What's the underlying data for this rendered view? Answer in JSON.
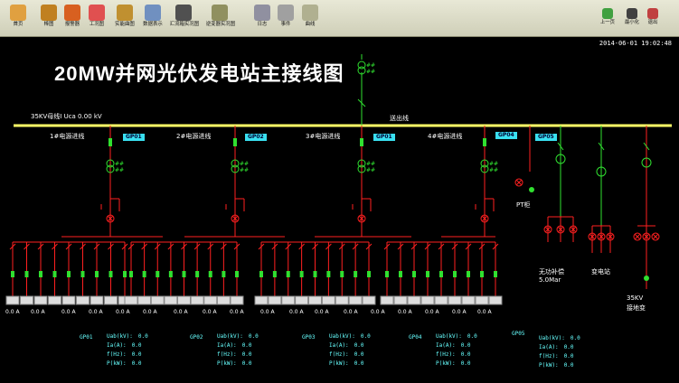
{
  "toolbar": {
    "items": [
      {
        "label": "首页",
        "color": "#e0a040"
      },
      {
        "label": "棒图",
        "color": "#c08020"
      },
      {
        "label": "报警器",
        "color": "#d86020"
      },
      {
        "label": "工况图",
        "color": "#e05050"
      },
      {
        "label": "实能曲图",
        "color": "#c09030"
      },
      {
        "label": "数据表示",
        "color": "#7090c0"
      },
      {
        "label": "汇流箱实况图",
        "color": "#505050"
      },
      {
        "label": "逆变器实况图",
        "color": "#909060"
      },
      {
        "label": "日志",
        "color": "#9090a0"
      },
      {
        "label": "事件",
        "color": "#a0a0a0"
      },
      {
        "label": "曲线",
        "color": "#b0b090"
      }
    ],
    "right_items": [
      {
        "label": "上一页",
        "color": "#40a040"
      },
      {
        "label": "最小化",
        "color": "#404040"
      },
      {
        "label": "退出",
        "color": "#c04040"
      }
    ]
  },
  "datetime": "2014-06-01 19:02:48",
  "title": "20MW并网光伏发电站主接线图",
  "bus_label": "35KV母线Ⅰ  Uca    0.00    kV",
  "outgoing_label": "送出线",
  "feeders": [
    {
      "label": "1#电源进线",
      "tag": "GP01"
    },
    {
      "label": "2#电源进线",
      "tag": "GP02"
    },
    {
      "label": "3#电源进线",
      "tag": "GP01"
    },
    {
      "label": "4#电源进线",
      "tag": "GP04"
    },
    {
      "tag": "GP05"
    }
  ],
  "right_labels": {
    "pt": "PT柜",
    "reactive": "无功补偿",
    "reactive_value": "5.0Mar",
    "substation": "变电站",
    "grounding_a": "35KV",
    "grounding_b": "接地变"
  },
  "transformer_mark": "##",
  "inverter_reading": "0.0  A",
  "panels": [
    {
      "tag": "GP01",
      "rows": [
        {
          "k": "Uab(kV):",
          "v": "0.0"
        },
        {
          "k": "Ia(A):",
          "v": "0.0"
        },
        {
          "k": "f(Hz):",
          "v": "0.0"
        },
        {
          "k": "P(kW):",
          "v": "0.0"
        }
      ]
    },
    {
      "tag": "GP02",
      "rows": [
        {
          "k": "Uab(kV):",
          "v": "0.0"
        },
        {
          "k": "Ia(A):",
          "v": "0.0"
        },
        {
          "k": "f(Hz):",
          "v": "0.0"
        },
        {
          "k": "P(kW):",
          "v": "0.0"
        }
      ]
    },
    {
      "tag": "GP03",
      "rows": [
        {
          "k": "Uab(kV):",
          "v": "0.0"
        },
        {
          "k": "Ia(A):",
          "v": "0.0"
        },
        {
          "k": "f(Hz):",
          "v": "0.0"
        },
        {
          "k": "P(kW):",
          "v": "0.0"
        }
      ]
    },
    {
      "tag": "GP04",
      "rows": [
        {
          "k": "Uab(kV):",
          "v": "0.0"
        },
        {
          "k": "Ia(A):",
          "v": "0.0"
        },
        {
          "k": "f(Hz):",
          "v": "0.0"
        },
        {
          "k": "P(kW):",
          "v": "0.0"
        }
      ]
    },
    {
      "tag": "GP05",
      "rows": [
        {
          "k": "Uab(kV):",
          "v": "0.0"
        },
        {
          "k": "Ia(A):",
          "v": "0.0"
        },
        {
          "k": "f(Hz):",
          "v": "0.0"
        },
        {
          "k": "P(kW):",
          "v": "0.0"
        }
      ]
    }
  ],
  "colors": {
    "bus": "#ffff66",
    "line_red": "#ff2020",
    "line_green": "#30e030",
    "tag": "#39e0f0"
  }
}
